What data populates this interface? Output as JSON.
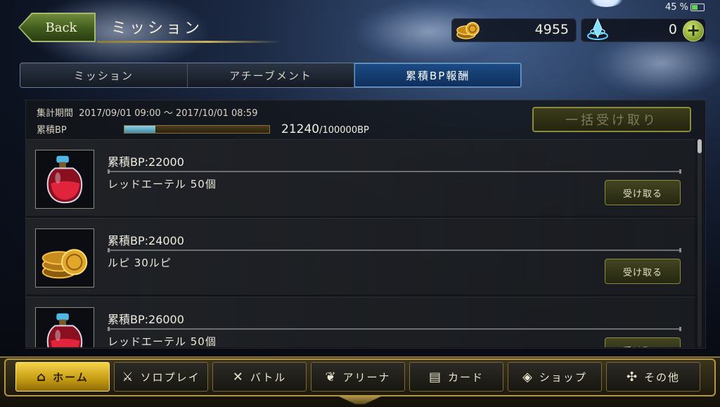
{
  "status": {
    "battery": "45 %"
  },
  "header": {
    "back_label": "Back",
    "title": "ミッション",
    "gold_value": "4955",
    "crystal_value": "0",
    "plus_label": "+"
  },
  "tabs": [
    {
      "label": "ミッション",
      "active": false
    },
    {
      "label": "アチーブメント",
      "active": false
    },
    {
      "label": "累積BP報酬",
      "active": true
    }
  ],
  "summary": {
    "period_label": "集計期間",
    "period_value": "2017/09/01 09:00 〜 2017/10/01 08:59",
    "bp_label": "累積BP",
    "bp_current": "21240",
    "bp_total": "/100000BP",
    "bp_progress": 0.2124,
    "bulk_label": "一括受け取り"
  },
  "rewards": [
    {
      "title": "累積BP:22000",
      "reward": "レッドエーテル 50個",
      "icon": "red-ether-bottle-icon",
      "claim_label": "受け取る"
    },
    {
      "title": "累積BP:24000",
      "reward": "ルピ 30ルピ",
      "icon": "rupee-coins-icon",
      "claim_label": "受け取る"
    },
    {
      "title": "累積BP:26000",
      "reward": "レッドエーテル 50個",
      "icon": "red-ether-bottle-icon",
      "claim_label": "受け取る"
    }
  ],
  "nav": [
    {
      "label": "ホーム",
      "icon": "home-icon",
      "active": true
    },
    {
      "label": "ソロプレイ",
      "icon": "solo-play-icon",
      "active": false
    },
    {
      "label": "バトル",
      "icon": "crossed-swords-icon",
      "active": false
    },
    {
      "label": "アリーナ",
      "icon": "arena-wreath-icon",
      "active": false
    },
    {
      "label": "カード",
      "icon": "cards-icon",
      "active": false
    },
    {
      "label": "ショップ",
      "icon": "shop-icon",
      "active": false
    },
    {
      "label": "その他",
      "icon": "others-icon",
      "active": false
    }
  ],
  "colors": {
    "accent_gold": "#c9a23a",
    "active_tab": "#1c4c86",
    "claim_border": "#8b8d3b"
  }
}
